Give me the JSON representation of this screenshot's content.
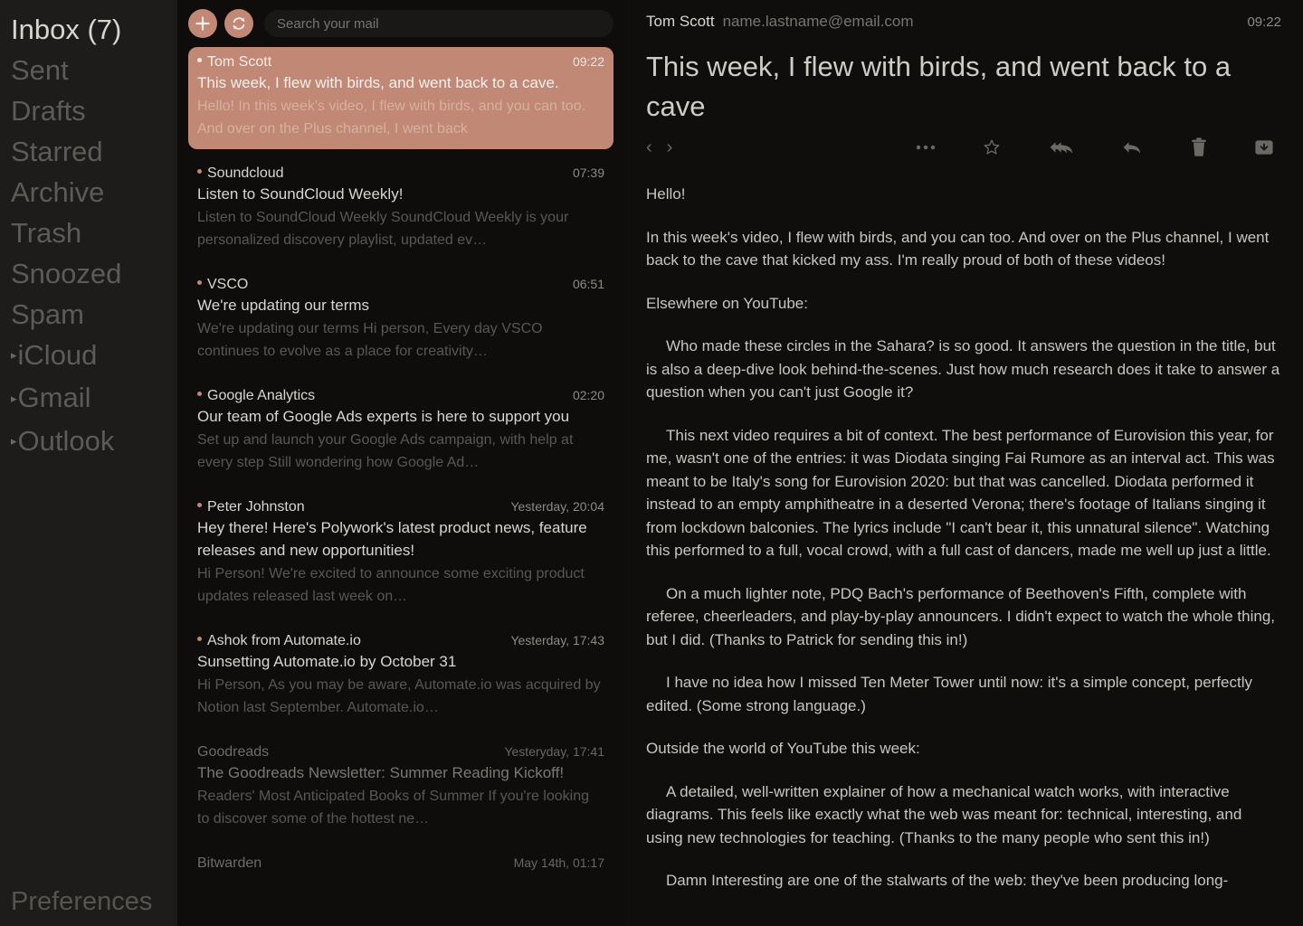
{
  "sidebar": {
    "folders": [
      {
        "label": "Inbox (7)",
        "active": true,
        "expandable": false
      },
      {
        "label": "Sent",
        "active": false,
        "expandable": false
      },
      {
        "label": "Drafts",
        "active": false,
        "expandable": false
      },
      {
        "label": "Starred",
        "active": false,
        "expandable": false
      },
      {
        "label": "Archive",
        "active": false,
        "expandable": false
      },
      {
        "label": "Trash",
        "active": false,
        "expandable": false
      },
      {
        "label": "Snoozed",
        "active": false,
        "expandable": false
      },
      {
        "label": "Spam",
        "active": false,
        "expandable": false
      },
      {
        "label": "iCloud",
        "active": false,
        "expandable": true
      },
      {
        "label": "Gmail",
        "active": false,
        "expandable": true
      },
      {
        "label": "Outlook",
        "active": false,
        "expandable": true
      }
    ],
    "preferences_label": "Preferences"
  },
  "toolbar": {
    "compose_icon": "plus-icon",
    "refresh_icon": "refresh-icon",
    "search_placeholder": "Search your mail",
    "search_value": ""
  },
  "mail_list": [
    {
      "from": "Tom Scott",
      "time": "09:22",
      "subject": "This week, I flew with birds, and went back to a cave.",
      "preview": "Hello! In this week's video, I flew with birds, and you can too. And over on the Plus channel, I went back",
      "unread": true,
      "selected": true
    },
    {
      "from": "Soundcloud",
      "time": "07:39",
      "subject": "Listen to SoundCloud Weekly!",
      "preview": "Listen to SoundCloud Weekly SoundCloud Weekly is your personalized discovery playlist, updated ev…",
      "unread": true,
      "selected": false
    },
    {
      "from": "VSCO",
      "time": "06:51",
      "subject": "We're updating our terms",
      "preview": "We're updating our terms Hi person, Every day VSCO continues to evolve as a place for creativity…",
      "unread": true,
      "selected": false
    },
    {
      "from": "Google Analytics",
      "time": "02:20",
      "subject": "Our team of Google Ads experts is here to support you",
      "preview": "Set up and launch your Google Ads campaign, with help at every step Still wondering how Google Ad…",
      "unread": true,
      "selected": false
    },
    {
      "from": "Peter Johnston",
      "time": "Yesterday, 20:04",
      "subject": "Hey there! Here's Polywork's latest product news, feature releases and new opportunities!",
      "preview": "Hi Person! We're excited to announce some exciting product updates released last week on…",
      "unread": true,
      "selected": false
    },
    {
      "from": "Ashok from Automate.io",
      "time": "Yesterday, 17:43",
      "subject": "Sunsetting Automate.io by October 31",
      "preview": "Hi Person, As you may be aware, Automate.io was acquired by Notion last September. Automate.io…",
      "unread": true,
      "selected": false
    },
    {
      "from": "Goodreads",
      "time": "Yesteryday, 17:41",
      "subject": "The Goodreads Newsletter: Summer Reading Kickoff!",
      "preview": "Readers' Most Anticipated Books of Summer If you're looking to discover some of the hottest ne…",
      "unread": false,
      "selected": false
    },
    {
      "from": "Bitwarden",
      "time": "May 14th, 01:17",
      "subject": "",
      "preview": "",
      "unread": false,
      "selected": false
    }
  ],
  "reader": {
    "sender_name": "Tom Scott",
    "sender_email": "name.lastname@email.com",
    "time": "09:22",
    "subject": "This week, I flew with birds, and went back to a cave",
    "actions": {
      "prev_icon": "chevron-left-icon",
      "next_icon": "chevron-right-icon",
      "more_icon": "ellipsis-icon",
      "star_icon": "star-icon",
      "reply_all_icon": "reply-all-icon",
      "reply_icon": "reply-icon",
      "delete_icon": "trash-icon",
      "archive_icon": "archive-icon"
    },
    "body": [
      {
        "text": "Hello!",
        "indent": false
      },
      {
        "text": "In this week's video, I flew with birds, and you can too. And over on the Plus channel, I went back to the cave that kicked my ass. I'm really proud of both of these videos!",
        "indent": false
      },
      {
        "text": "Elsewhere on YouTube:",
        "indent": false
      },
      {
        "text": "Who made these circles in the Sahara? is so good. It answers the question in the title, but is also a deep-dive look behind-the-scenes. Just how much research does it take to answer a question when you can't just Google it?",
        "indent": true
      },
      {
        "text": "This next video requires a bit of context. The best performance of Eurovision this year, for me, wasn't one of the entries: it was Diodata singing Fai Rumore as an interval act. This was meant to be Italy's song for Eurovision 2020: but that was cancelled. Diodata performed it instead to an empty amphitheatre in a deserted Verona; there's footage of Italians singing it from lockdown balconies. The lyrics include \"I can't bear it, this unnatural silence\". Watching this performed to a full, vocal crowd, with a full cast of dancers, made me well up just a little.",
        "indent": true
      },
      {
        "text": "On a much lighter note, PDQ Bach's performance of Beethoven's Fifth, complete with referee, cheerleaders, and play-by-play announcers. I didn't expect to watch the whole thing, but I did. (Thanks to Patrick for sending this in!)",
        "indent": true
      },
      {
        "text": "I have no idea how I missed Ten Meter Tower until now: it's a simple concept, perfectly edited. (Some strong language.)",
        "indent": true
      },
      {
        "text": "Outside the world of YouTube this week:",
        "indent": false
      },
      {
        "text": "A detailed, well-written explainer of how a mechanical watch works, with interactive diagrams. This feels like exactly what the web was meant for: technical, interesting, and using new technologies for teaching. (Thanks to the many people who sent this in!)",
        "indent": true
      },
      {
        "text": "Damn Interesting are one of the stalwarts of the web: they've been producing long-",
        "indent": true
      }
    ]
  },
  "colors": {
    "accent": "#c08875",
    "sidebar_bg": "#1d1c1a",
    "list_bg": "#0e0d0c",
    "reader_bg": "#0f0e0d",
    "text_primary": "#d9d6d0",
    "text_muted": "#5a5753"
  }
}
